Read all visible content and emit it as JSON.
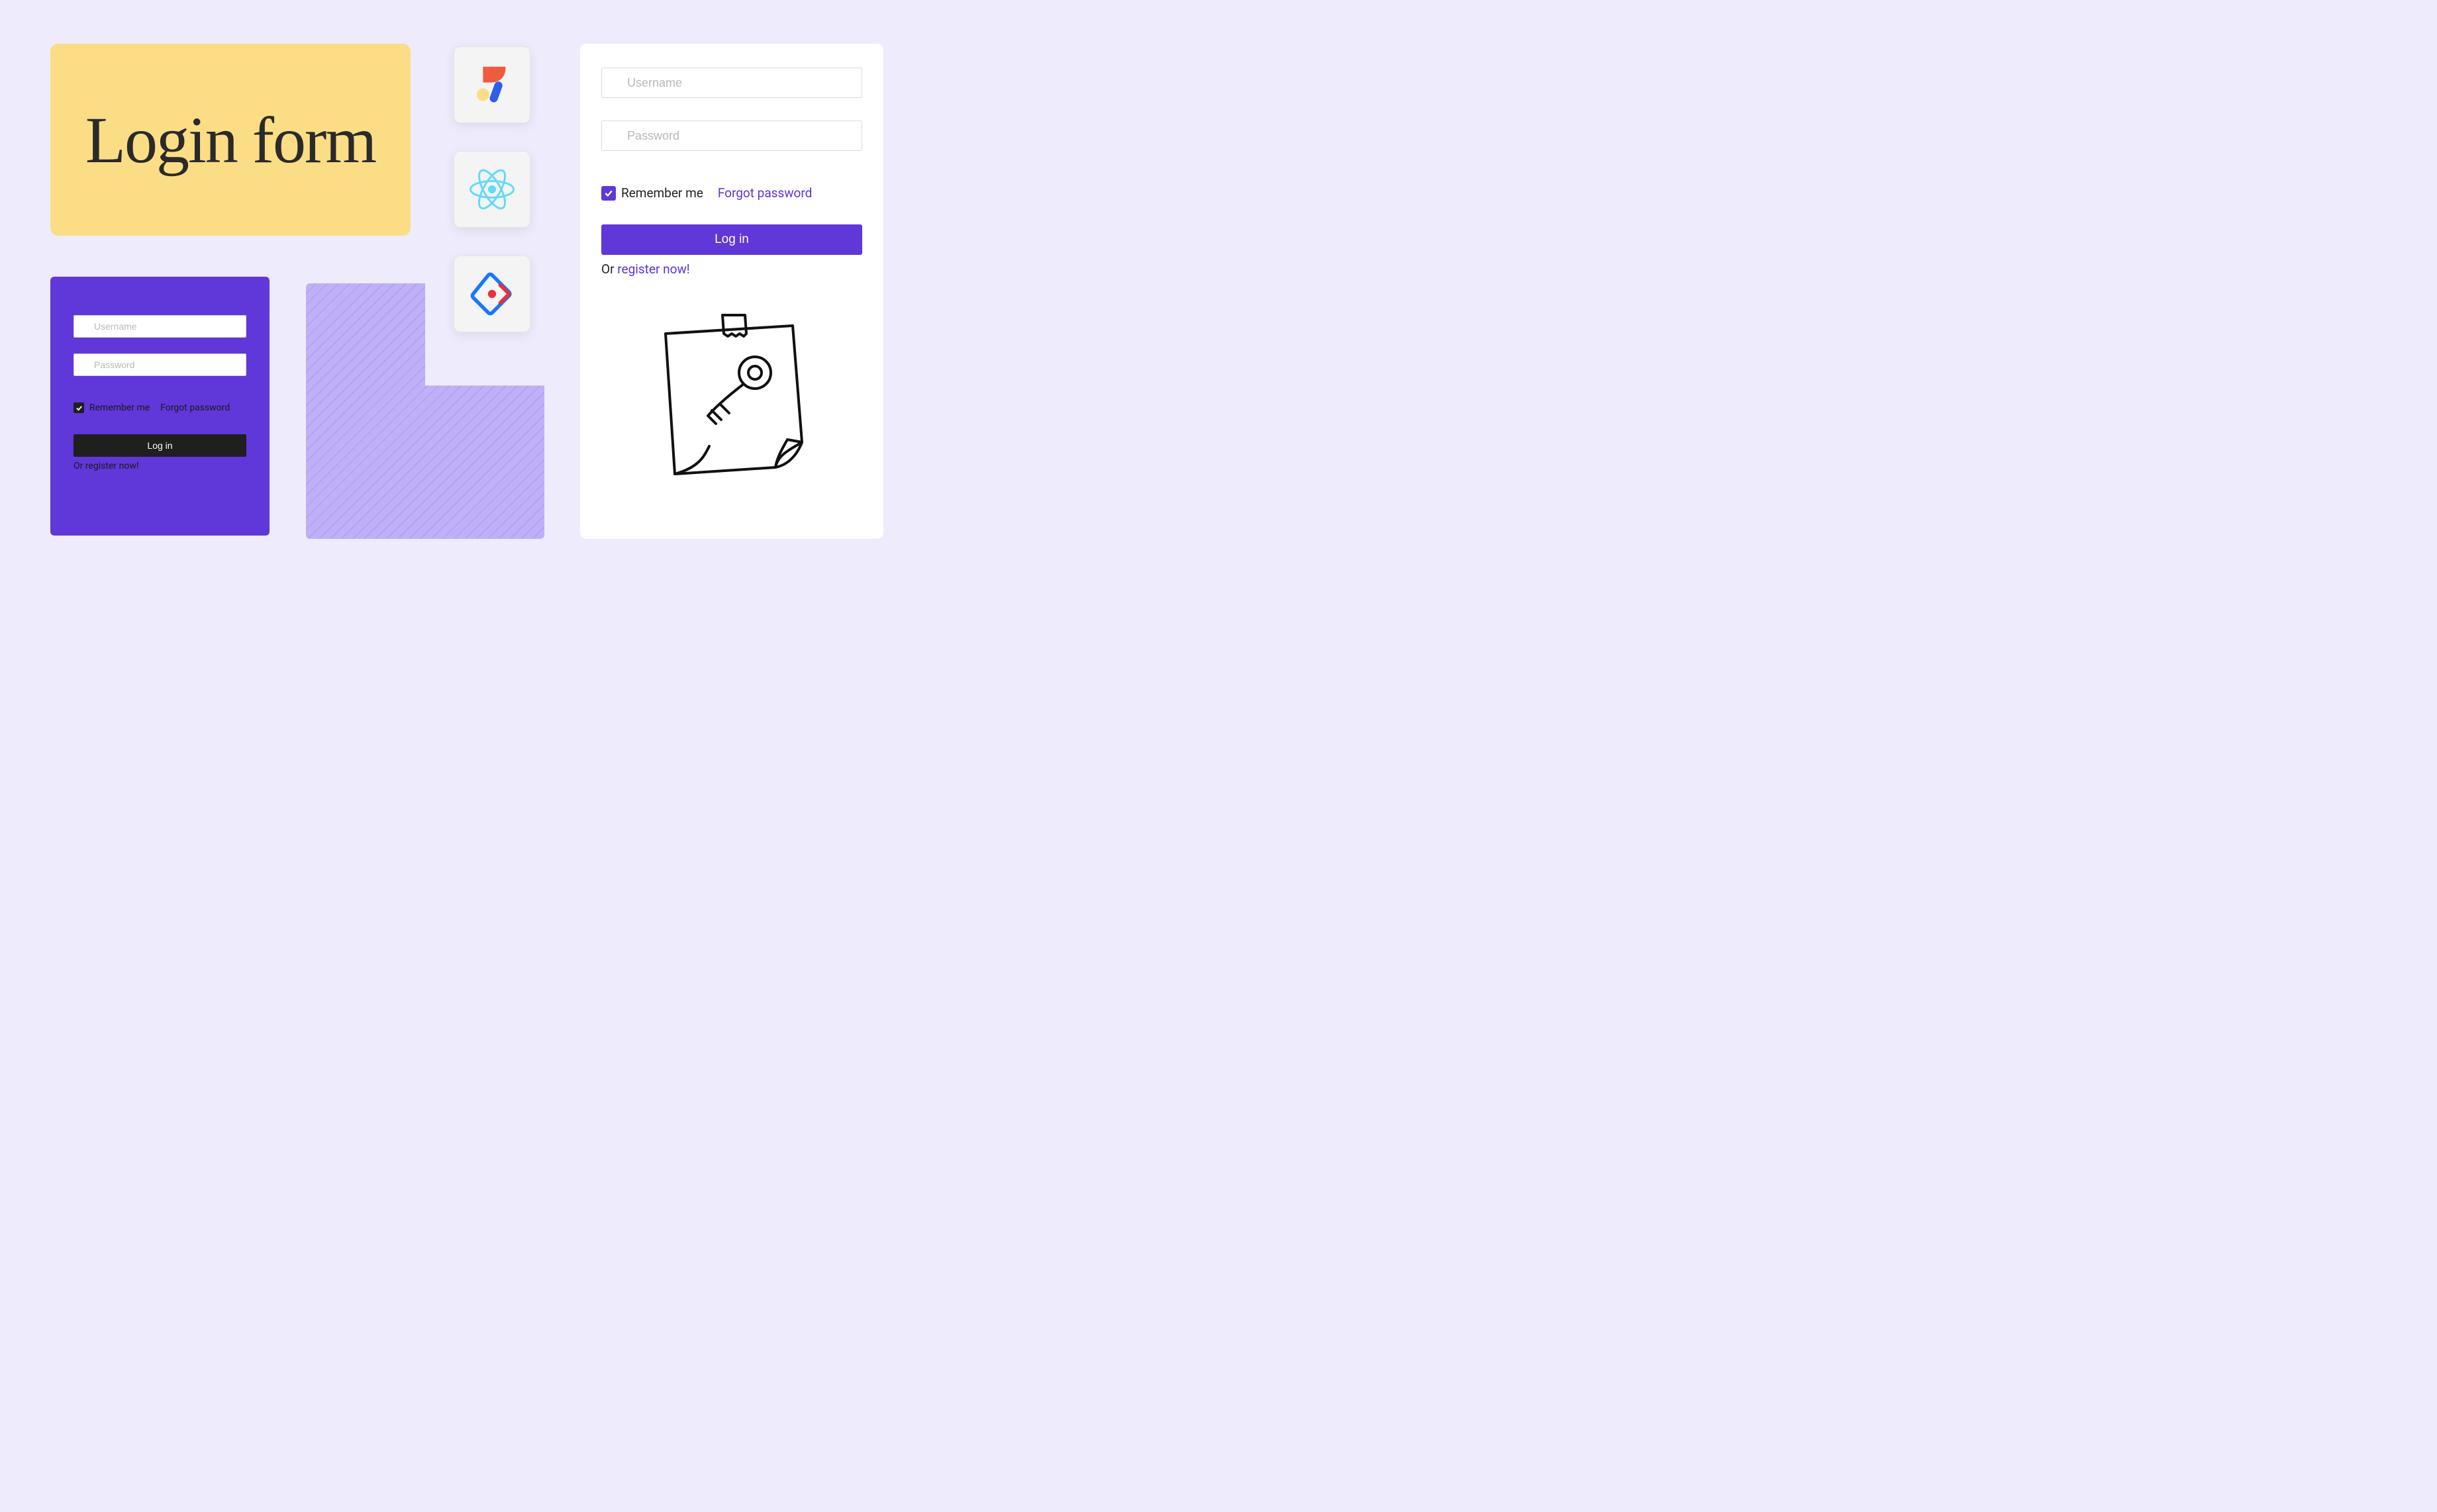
{
  "title": "Login form",
  "icons": [
    {
      "name": "abstract-shapes-icon"
    },
    {
      "name": "react-icon"
    },
    {
      "name": "ant-design-icon"
    }
  ],
  "form_dark": {
    "username_placeholder": "Username",
    "password_placeholder": "Password",
    "remember_label": "Remember me",
    "forgot_label": "Forgot password",
    "login_button": "Log in",
    "or_prefix": "Or ",
    "register_link": "register now!",
    "remember_checked": true
  },
  "form_light": {
    "username_placeholder": "Username",
    "password_placeholder": "Password",
    "remember_label": "Remember me",
    "forgot_label": "Forgot password",
    "login_button": "Log in",
    "or_prefix": "Or ",
    "register_link": "register now!",
    "remember_checked": true
  },
  "colors": {
    "accent": "#6037D9",
    "bg": "#EEEBFC",
    "yellow": "#FBDD85",
    "lavender": "#BFB0F7"
  }
}
